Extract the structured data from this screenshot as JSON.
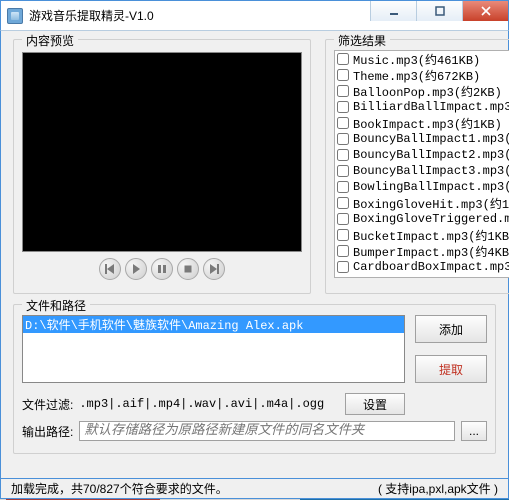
{
  "window": {
    "title": "游戏音乐提取精灵-V1.0"
  },
  "preview": {
    "label": "内容预览"
  },
  "result": {
    "label": "筛选结果",
    "items": [
      "Music.mp3(约461KB)",
      "Theme.mp3(约672KB)",
      "BalloonPop.mp3(约2KB)",
      "BilliardBallImpact.mp3",
      "BookImpact.mp3(约1KB)",
      "BouncyBallImpact1.mp3(",
      "BouncyBallImpact2.mp3(",
      "BouncyBallImpact3.mp3(",
      "BowlingBallImpact.mp3(",
      "BoxingGloveHit.mp3(约1",
      "BoxingGloveTriggered.m",
      "BucketImpact.mp3(约1KB",
      "BumperImpact.mp3(约4KB",
      "CardboardBoxImpact.mp3"
    ]
  },
  "files": {
    "label": "文件和路径",
    "selected_path": "D:\\软件\\手机软件\\魅族软件\\Amazing Alex.apk",
    "btn_add": "添加",
    "btn_extract": "提取",
    "filter_label": "文件过滤:",
    "filter_exts": ".mp3|.aif|.mp4|.wav|.avi|.m4a|.ogg",
    "btn_settings": "设置",
    "out_label": "输出路径:",
    "out_placeholder": "默认存储路径为原路径新建原文件的同名文件夹",
    "browse_label": "..."
  },
  "status": {
    "left": "加载完成，共70/827个符合要求的文件。",
    "right": "( 支持ipa,pxl,apk文件 )"
  }
}
